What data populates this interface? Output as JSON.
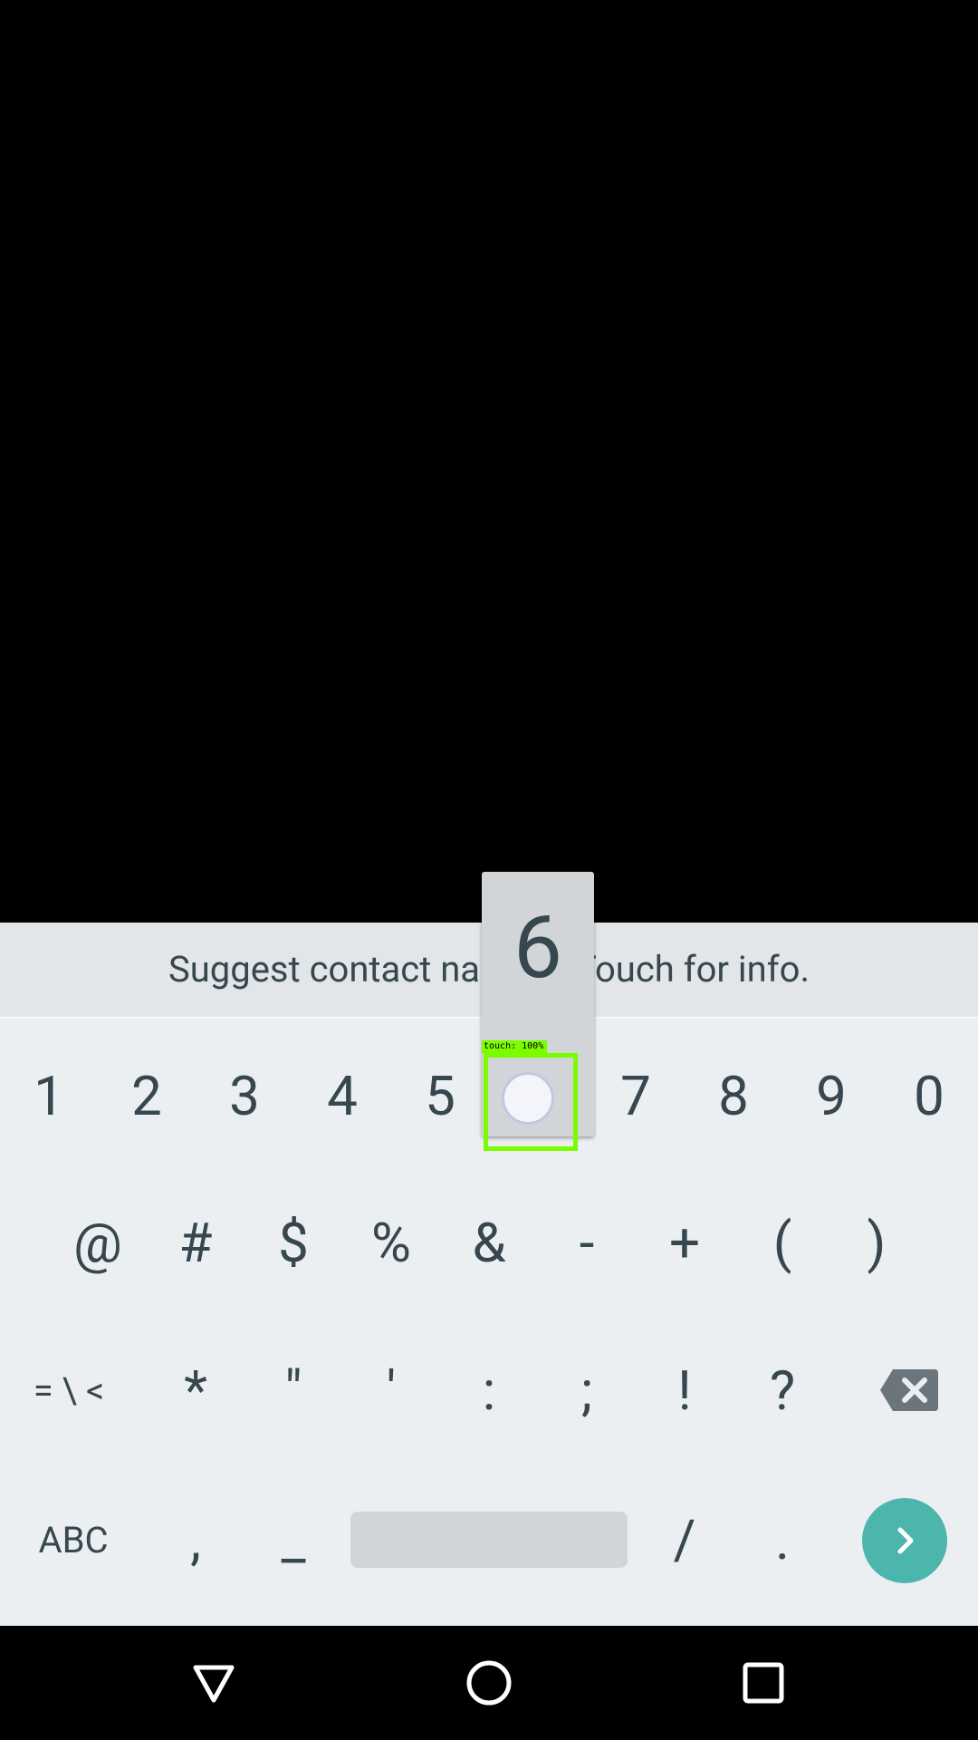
{
  "suggestion": "Suggest contact names? Touch for info.",
  "popup_key": "6",
  "touch_indicator": "touch: 100%",
  "rows": {
    "row1": [
      "1",
      "2",
      "3",
      "4",
      "5",
      "6",
      "7",
      "8",
      "9",
      "0"
    ],
    "row2": [
      "@",
      "#",
      "$",
      "%",
      "&",
      "-",
      "+",
      "(",
      ")"
    ],
    "row3": [
      "= \\ <",
      "*",
      "\"",
      "'",
      ":",
      ";",
      "!",
      "?"
    ],
    "row4": [
      "ABC",
      ",",
      "_",
      "/",
      "."
    ]
  },
  "icons": {
    "backspace": "backspace-icon",
    "enter": "chevron-right-icon",
    "nav_back": "triangle-back-icon",
    "nav_home": "circle-home-icon",
    "nav_recents": "square-recents-icon"
  },
  "colors": {
    "keyboard_bg": "#eceff1",
    "key_text": "#37474f",
    "enter_accent": "#4db6ac",
    "touch_indicator": "#7cfc00"
  }
}
